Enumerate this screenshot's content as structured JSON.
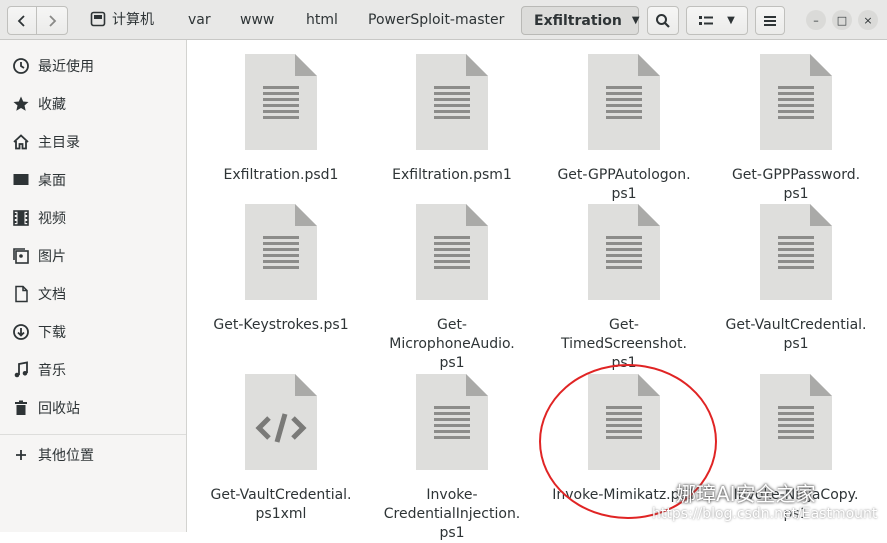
{
  "header": {
    "back_label": "‹",
    "forward_label": "›",
    "breadcrumbs": [
      {
        "label": "计算机"
      },
      {
        "label": "var"
      },
      {
        "label": "www"
      },
      {
        "label": "html"
      },
      {
        "label": "PowerSploit-master"
      }
    ],
    "active_folder": "Exfiltration",
    "search_icon": "search-icon",
    "view_icon": "list-view-icon",
    "menu_icon": "hamburger-menu-icon",
    "window_controls": {
      "minimize": "–",
      "maximize": "□",
      "close": "×"
    }
  },
  "sidebar": {
    "items": [
      {
        "label": "最近使用",
        "icon": "recent-icon"
      },
      {
        "label": "收藏",
        "icon": "star-icon"
      },
      {
        "label": "主目录",
        "icon": "home-icon"
      },
      {
        "label": "桌面",
        "icon": "desktop-icon"
      },
      {
        "label": "视频",
        "icon": "video-icon"
      },
      {
        "label": "图片",
        "icon": "pictures-icon"
      },
      {
        "label": "文档",
        "icon": "documents-icon"
      },
      {
        "label": "下载",
        "icon": "download-icon"
      },
      {
        "label": "音乐",
        "icon": "music-icon"
      },
      {
        "label": "回收站",
        "icon": "trash-icon"
      },
      {
        "label": "其他位置",
        "icon": "plus-icon"
      }
    ]
  },
  "files": [
    {
      "name": "Exfiltration.psd1",
      "icon": "text-document-icon"
    },
    {
      "name": "Exfiltration.psm1",
      "icon": "text-document-icon"
    },
    {
      "name": "Get-GPPAutologon.\nps1",
      "icon": "text-document-icon"
    },
    {
      "name": "Get-GPPPassword.\nps1",
      "icon": "text-document-icon"
    },
    {
      "name": "Get-Keystrokes.ps1",
      "icon": "text-document-icon"
    },
    {
      "name": "Get-\nMicrophoneAudio.\nps1",
      "icon": "text-document-icon"
    },
    {
      "name": "Get-\nTimedScreenshot.\nps1",
      "icon": "text-document-icon"
    },
    {
      "name": "Get-VaultCredential.\nps1",
      "icon": "text-document-icon"
    },
    {
      "name": "Get-VaultCredential.\nps1xml",
      "icon": "code-document-icon"
    },
    {
      "name": "Invoke-\nCredentialInjection.\nps1",
      "icon": "text-document-icon"
    },
    {
      "name": "Invoke-Mimikatz.ps1",
      "icon": "text-document-icon"
    },
    {
      "name": "Invoke-NinjaCopy.\nps1",
      "icon": "text-document-icon"
    }
  ],
  "annotation": {
    "color": "#e02424"
  },
  "watermark": {
    "text": "娜璋AI安全之家",
    "url_text": "https://blog.csdn.net/Eastmount"
  }
}
